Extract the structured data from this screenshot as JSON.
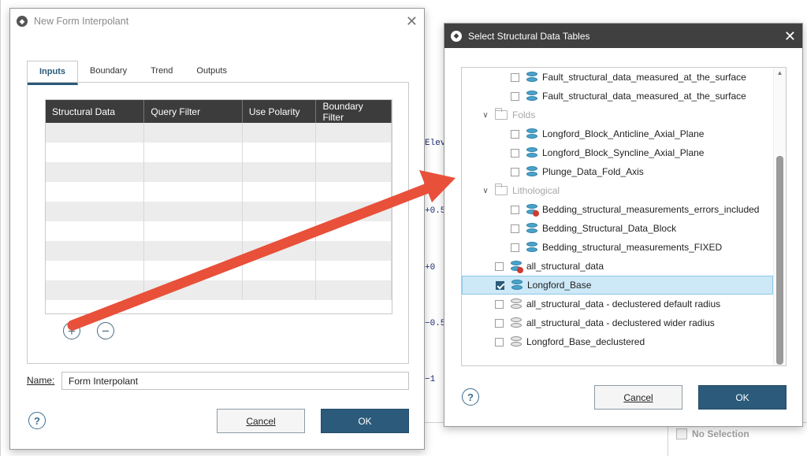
{
  "background": {
    "axis_labels": [
      "Elev",
      "+0.5",
      "+0",
      "−0.5",
      "−1"
    ],
    "status_text": "No Selection"
  },
  "form_dialog": {
    "title": "New Form Interpolant",
    "tabs": [
      "Inputs",
      "Boundary",
      "Trend",
      "Outputs"
    ],
    "active_tab": "Inputs",
    "columns": [
      "Structural Data",
      "Query Filter",
      "Use Polarity",
      "Boundary Filter"
    ],
    "rows": 9,
    "add_icon": "plus-circle-icon",
    "remove_icon": "minus-circle-icon",
    "name_label": "Name:",
    "name_value": "Form Interpolant",
    "help_glyph": "?",
    "cancel_label": "Cancel",
    "ok_label": "OK"
  },
  "tables_dialog": {
    "title": "Select Structural Data Tables",
    "items": [
      {
        "label": "Fault_structural_data_measured_at_the_surface",
        "kind": "table",
        "level": 2,
        "checked": false,
        "icon": "structural-data-icon"
      },
      {
        "label": "Fault_structural_data_measured_at_the_surface",
        "kind": "table",
        "level": 2,
        "checked": false,
        "icon": "structural-data-icon"
      },
      {
        "label": "Folds",
        "kind": "folder",
        "level": 1,
        "expanded": true,
        "icon": "folder-icon"
      },
      {
        "label": "Longford_Block_Anticline_Axial_Plane",
        "kind": "table",
        "level": 2,
        "checked": false,
        "icon": "structural-data-icon"
      },
      {
        "label": "Longford_Block_Syncline_Axial_Plane",
        "kind": "table",
        "level": 2,
        "checked": false,
        "icon": "structural-data-icon"
      },
      {
        "label": "Plunge_Data_Fold_Axis",
        "kind": "table",
        "level": 2,
        "checked": false,
        "icon": "structural-data-icon"
      },
      {
        "label": "Lithological",
        "kind": "folder",
        "level": 1,
        "expanded": true,
        "icon": "folder-icon"
      },
      {
        "label": "Bedding_structural_measurements_errors_included",
        "kind": "table",
        "level": 2,
        "checked": false,
        "icon": "structural-data-error-icon"
      },
      {
        "label": "Bedding_Structural_Data_Block",
        "kind": "table",
        "level": 2,
        "checked": false,
        "icon": "structural-data-icon"
      },
      {
        "label": "Bedding_structural_measurements_FIXED",
        "kind": "table",
        "level": 2,
        "checked": false,
        "icon": "structural-data-icon"
      },
      {
        "label": "all_structural_data",
        "kind": "table",
        "level": 0,
        "checked": false,
        "icon": "structural-data-error-icon"
      },
      {
        "label": "Longford_Base",
        "kind": "table",
        "level": 0,
        "checked": true,
        "selected": true,
        "icon": "structural-data-icon"
      },
      {
        "label": "all_structural_data - declustered default radius",
        "kind": "table",
        "level": 0,
        "checked": false,
        "icon": "declustered-data-icon"
      },
      {
        "label": "all_structural_data - declustered wider radius",
        "kind": "table",
        "level": 0,
        "checked": false,
        "icon": "declustered-data-icon"
      },
      {
        "label": "Longford_Base_declustered",
        "kind": "table",
        "level": 0,
        "checked": false,
        "icon": "declustered-data-icon"
      }
    ],
    "help_glyph": "?",
    "cancel_label": "Cancel",
    "ok_label": "OK"
  },
  "colors": {
    "accent": "#2b5a7a",
    "selection": "#cde8f7",
    "annotation_arrow": "#e8503a"
  }
}
